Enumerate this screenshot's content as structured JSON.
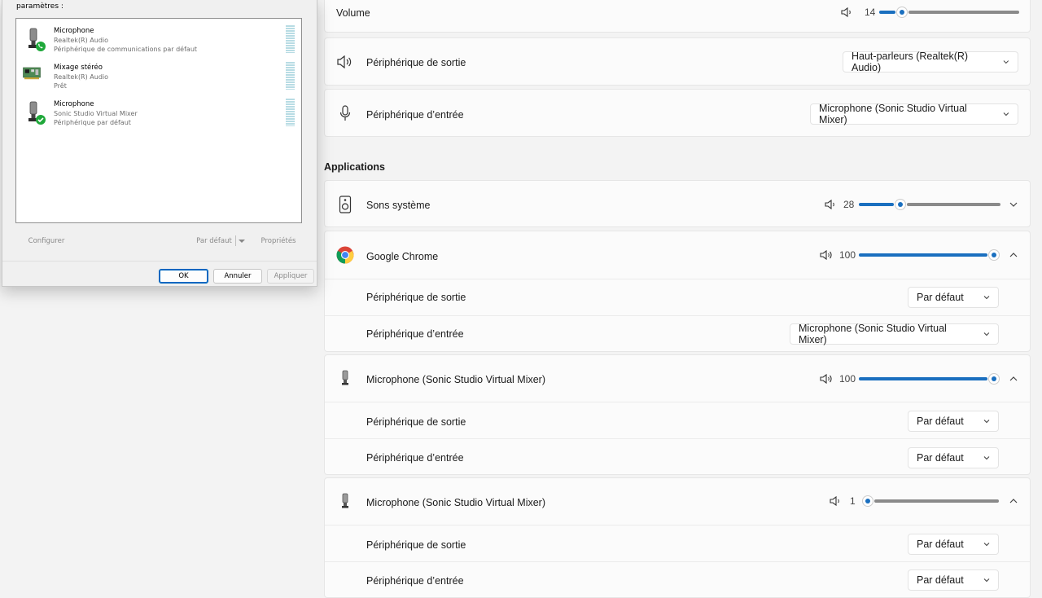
{
  "dialog": {
    "header_text": "paramètres :",
    "devices": [
      {
        "name": "Microphone",
        "driver": "Realtek(R) Audio",
        "status": "Périphérique de communications par défaut",
        "badge": "phone"
      },
      {
        "name": "Mixage stéréo",
        "driver": "Realtek(R) Audio",
        "status": "Prêt",
        "badge": "none"
      },
      {
        "name": "Microphone",
        "driver": "Sonic Studio Virtual Mixer",
        "status": "Périphérique par défaut",
        "badge": "check"
      }
    ],
    "configure_label": "Configurer",
    "default_label": "Par défaut",
    "properties_label": "Propriétés",
    "ok_label": "OK",
    "cancel_label": "Annuler",
    "apply_label": "Appliquer"
  },
  "volume": {
    "label": "Volume",
    "value": "14",
    "level": 14
  },
  "output_device": {
    "label": "Périphérique de sortie",
    "value": "Haut-parleurs (Realtek(R) Audio)"
  },
  "input_device": {
    "label": "Périphérique d’entrée",
    "value": "Microphone (Sonic Studio Virtual Mixer)"
  },
  "applications_title": "Applications",
  "apps": [
    {
      "name": "Sons système",
      "volume": "28",
      "level": 28,
      "expanded": false,
      "icon": "speaker-box-icon"
    },
    {
      "name": "Google Chrome",
      "volume": "100",
      "level": 100,
      "expanded": true,
      "icon": "chrome-icon",
      "output_label": "Périphérique de sortie",
      "output_value": "Par défaut",
      "input_label": "Périphérique d’entrée",
      "input_value": "Microphone (Sonic Studio Virtual Mixer)"
    },
    {
      "name": "Microphone (Sonic Studio Virtual Mixer)",
      "volume": "100",
      "level": 100,
      "expanded": true,
      "icon": "microphone-app-icon",
      "output_label": "Périphérique de sortie",
      "output_value": "Par défaut",
      "input_label": "Périphérique d’entrée",
      "input_value": "Par défaut"
    },
    {
      "name": "Microphone (Sonic Studio Virtual Mixer)",
      "volume": "1",
      "level": 1,
      "expanded": true,
      "icon": "microphone-app-icon",
      "output_label": "Périphérique de sortie",
      "output_value": "Par défaut",
      "input_label": "Périphérique d’entrée",
      "input_value": "Par défaut"
    }
  ],
  "colors": {
    "accent": "#1a6fbf",
    "check_green": "#1fa83a"
  }
}
